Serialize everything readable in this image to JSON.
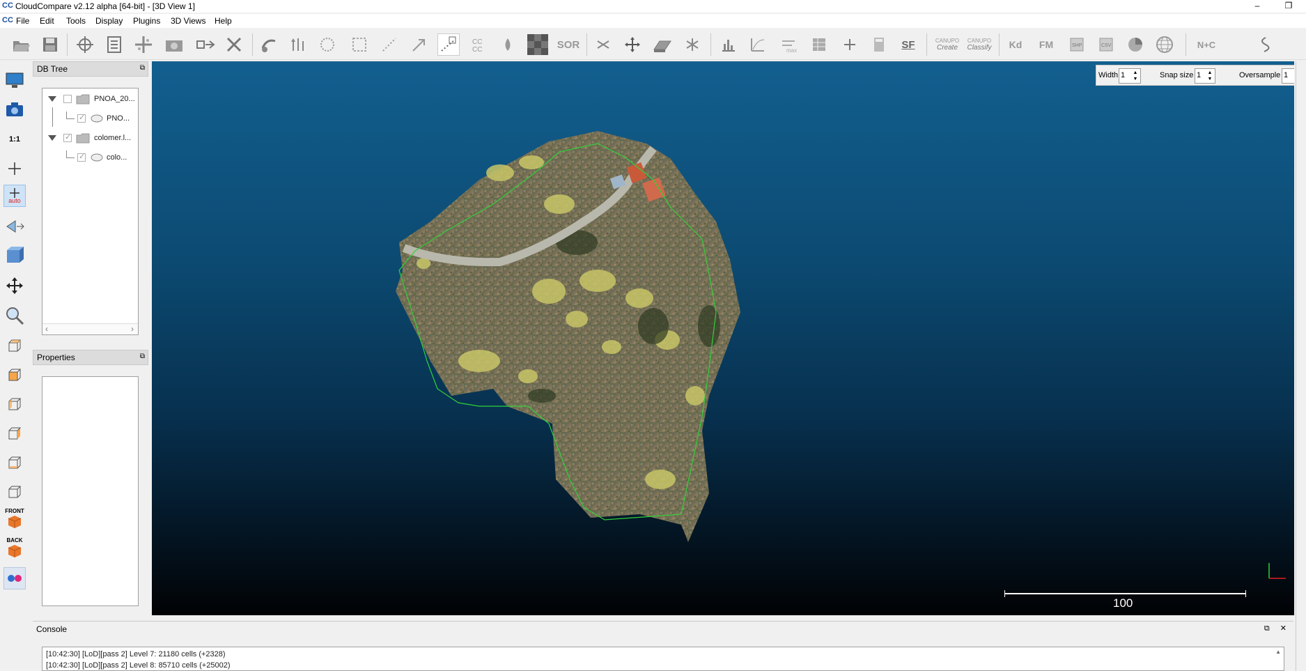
{
  "window": {
    "app_icon": "CC",
    "title": "CloudCompare v2.12 alpha [64-bit] - [3D View 1]",
    "minimize": "–",
    "restore": "❐"
  },
  "menu": {
    "mdi_icon": "CC",
    "items": [
      "File",
      "Edit",
      "Tools",
      "Display",
      "Plugins",
      "3D Views",
      "Help"
    ]
  },
  "toolbar": {
    "sor_label": "SOR",
    "sf_label": "SF",
    "canupo_create": "Create",
    "canupo_classify": "Classify",
    "canupo_title": "CANUPO",
    "kd_label": "Kd",
    "fm_label": "FM",
    "nc_label": "N+C"
  },
  "left_toolbar": {
    "one_to_one": "1:1",
    "auto_label": "auto",
    "front_label": "FRONT",
    "back_label": "BACK"
  },
  "db_tree": {
    "title": "DB Tree",
    "float_icon": "⧉",
    "items": [
      {
        "label": "PNOA_20...",
        "level": 0,
        "checked": false
      },
      {
        "label": "PNO...",
        "level": 1,
        "checked": true
      },
      {
        "label": "colomer.l...",
        "level": 0,
        "checked": true
      },
      {
        "label": "colo...",
        "level": 1,
        "checked": true
      }
    ],
    "scroll_left": "‹",
    "scroll_right": "›"
  },
  "properties": {
    "title": "Properties",
    "float_icon": "⧉"
  },
  "segment_toolbar": {
    "width_label": "Width",
    "width_value": "1",
    "snap_label": "Snap size",
    "snap_value": "1",
    "oversample_label": "Oversample",
    "oversample_value": "1",
    "spin_up": "▲",
    "spin_down": "▼"
  },
  "view": {
    "scale_label": "100"
  },
  "console": {
    "title": "Console",
    "float_icon": "⧉",
    "close_icon": "✕",
    "scroll_up": "▲",
    "lines": [
      "[10:42:30] [LoD][pass 2] Level 7: 21180 cells (+2328)",
      "[10:42:30] [LoD][pass 2] Level 8: 85710 cells (+25002)"
    ]
  },
  "colors": {
    "view_top": "#125f8f",
    "view_bottom": "#010204",
    "polyline": "#2fd13a",
    "accent": "#1a4f9c"
  }
}
